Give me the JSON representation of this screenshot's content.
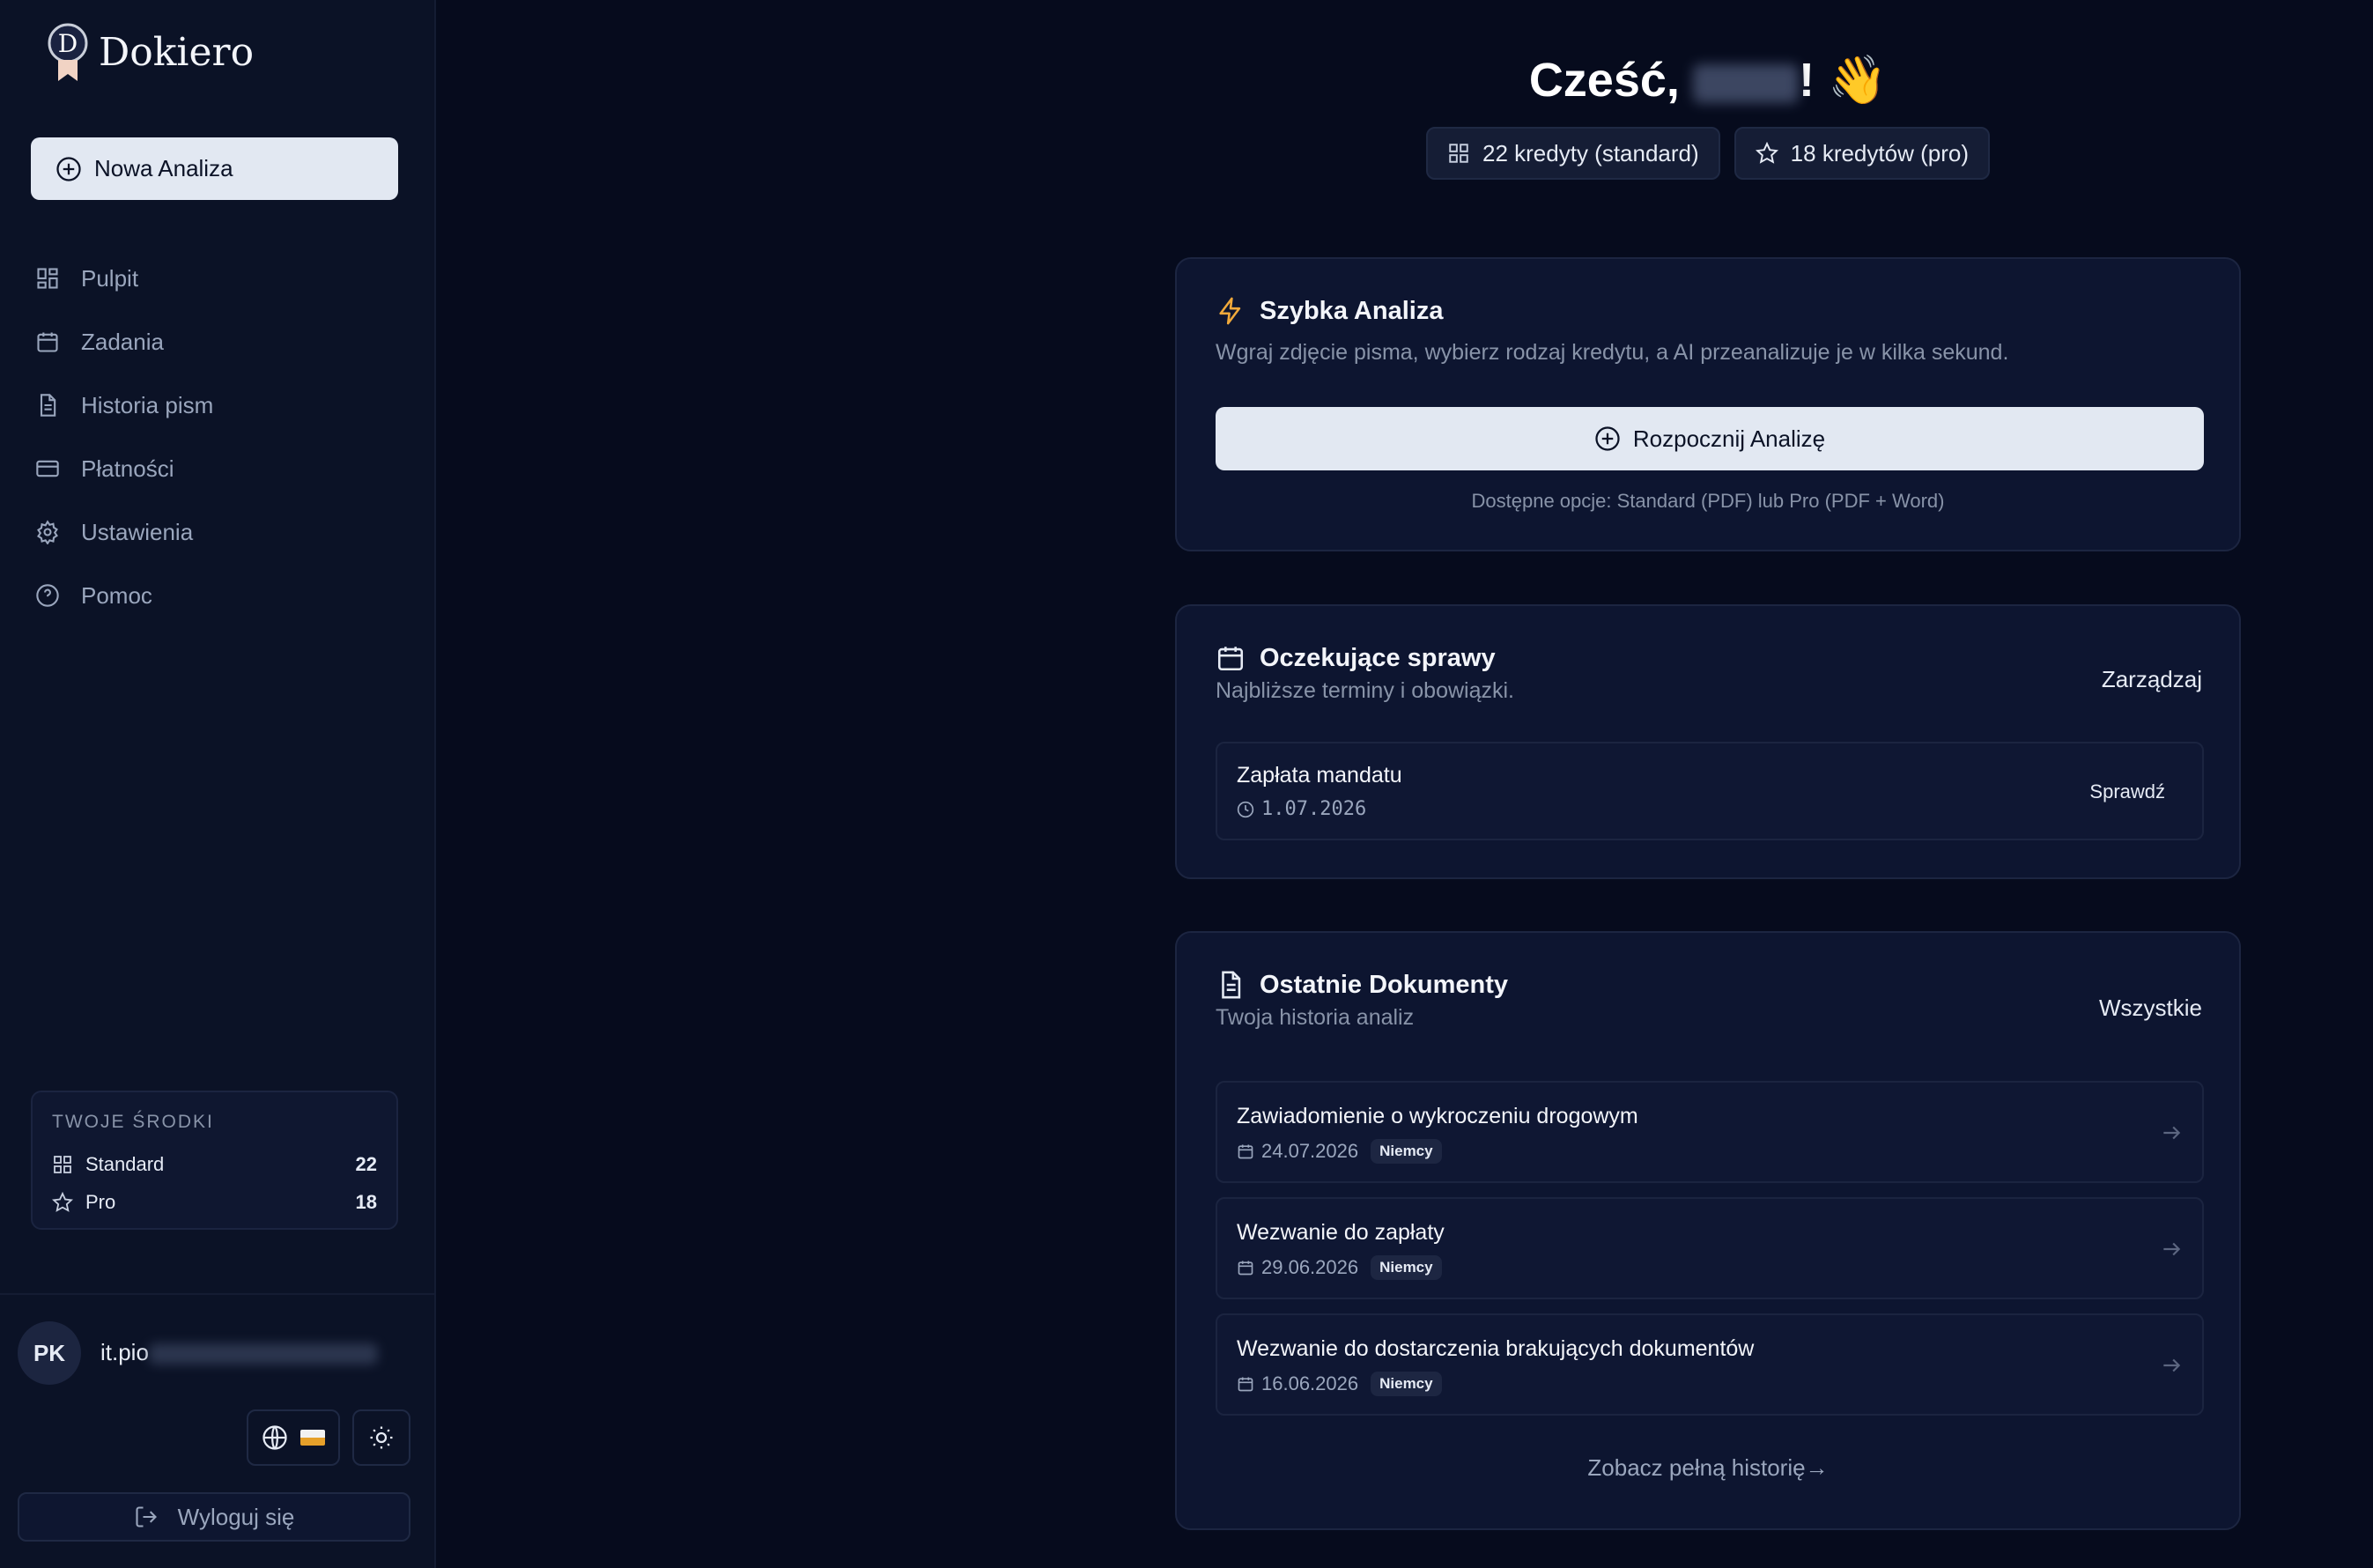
{
  "app": {
    "name": "Dokiero",
    "logo_letter": "D"
  },
  "sidebar": {
    "new_analysis": "Nowa Analiza",
    "items": [
      {
        "label": "Pulpit",
        "icon": "grid-icon"
      },
      {
        "label": "Zadania",
        "icon": "calendar-icon"
      },
      {
        "label": "Historia pism",
        "icon": "document-icon"
      },
      {
        "label": "Płatności",
        "icon": "credit-card-icon"
      },
      {
        "label": "Ustawienia",
        "icon": "gear-icon"
      },
      {
        "label": "Pomoc",
        "icon": "help-circle-icon"
      }
    ],
    "funds": {
      "title": "TWOJE ŚRODKI",
      "standard_label": "Standard",
      "standard_value": "22",
      "pro_label": "Pro",
      "pro_value": "18"
    },
    "user": {
      "initials": "PK",
      "email_visible": "it.pio"
    },
    "logout": "Wyloguj się"
  },
  "header": {
    "greeting_prefix": "Cześć,",
    "greeting_suffix": "!",
    "wave": "👋",
    "credits_standard": "22 kredyty (standard)",
    "credits_pro": "18 kredytów (pro)"
  },
  "quick": {
    "title": "Szybka Analiza",
    "subtitle": "Wgraj zdjęcie pisma, wybierz rodzaj kredytu, a AI przeanalizuje je w kilka sekund.",
    "button": "Rozpocznij Analizę",
    "options": "Dostępne opcje: Standard (PDF) lub Pro (PDF + Word)"
  },
  "pending": {
    "title": "Oczekujące sprawy",
    "subtitle": "Najbliższe terminy i obowiązki.",
    "manage": "Zarządzaj",
    "items": [
      {
        "title": "Zapłata mandatu",
        "date": "1.07.2026",
        "action": "Sprawdź"
      }
    ]
  },
  "recent": {
    "title": "Ostatnie Dokumenty",
    "subtitle": "Twoja historia analiz",
    "all": "Wszystkie",
    "items": [
      {
        "title": "Zawiadomienie o wykroczeniu drogowym",
        "date": "24.07.2026",
        "tag": "Niemcy"
      },
      {
        "title": "Wezwanie do zapłaty",
        "date": "29.06.2026",
        "tag": "Niemcy"
      },
      {
        "title": "Wezwanie do dostarczenia brakujących dokumentów",
        "date": "16.06.2026",
        "tag": "Niemcy"
      }
    ],
    "full_history": "Zobacz pełną historię→"
  },
  "colors": {
    "background": "#060b1d",
    "sidebar": "#0b1226",
    "card": "#0d1530",
    "accent_bolt": "#f0a93b",
    "button": "#e2e8f2"
  }
}
